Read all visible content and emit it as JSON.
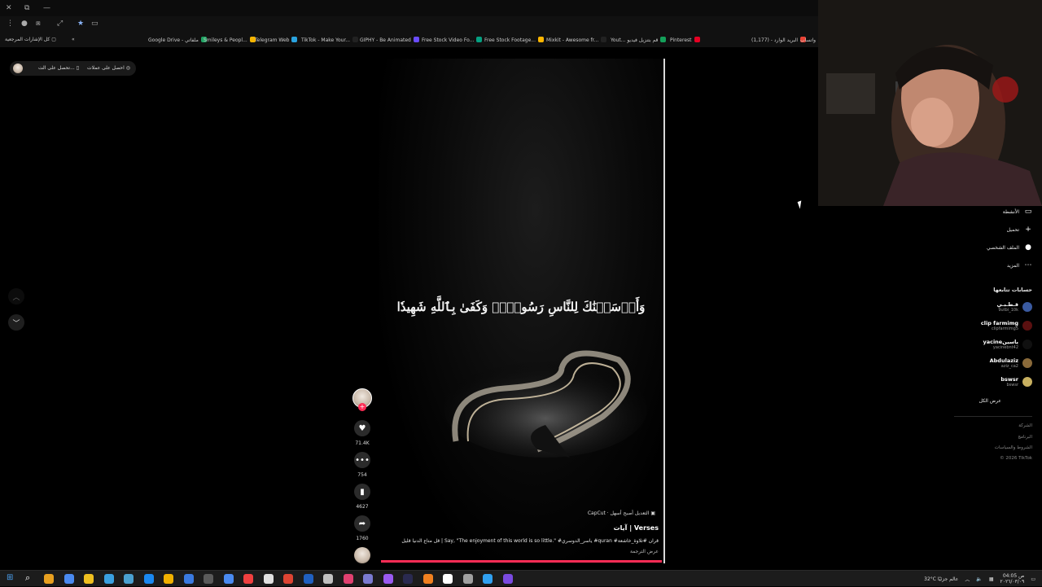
{
  "browser": {
    "window_controls": {
      "close": "✕",
      "restore": "⧉",
      "minimize": "—"
    },
    "bookmarks_all_label": "كل الإشارات المرجعية",
    "bookmarks": [
      {
        "label": "Google Drive - ملفاتي",
        "color": "#1fa463"
      },
      {
        "label": "Smileys & Peopl...",
        "color": "#f5b400"
      },
      {
        "label": "Telegram Web",
        "color": "#2aa3df"
      },
      {
        "label": "TikTok - Make Your...",
        "color": "#222222"
      },
      {
        "label": "GIPHY - Be Animated",
        "color": "#6a4cff"
      },
      {
        "label": "Free Stock Video Fo...",
        "color": "#05a081"
      },
      {
        "label": "Free Stock Footage...",
        "color": "#ffb600"
      },
      {
        "label": "Mixkit - Awesome fr...",
        "color": "#222222"
      },
      {
        "label": "Yout... قم بتنزيل فيديو",
        "color": "#14a05a"
      },
      {
        "label": "Pinterest",
        "color": "#e60023"
      },
      {
        "label": "البريد الوارد - (1,177)",
        "color": "#ea4335"
      },
      {
        "label": "واتساب",
        "color": "#25d366"
      }
    ]
  },
  "top_bar": {
    "get_app_label": "تحصل على الت...",
    "get_coins_label": "احصل على عملات"
  },
  "video": {
    "verse_text": "وَأَرۡسَلۡنَٰكَ لِلنَّاسِ رَسُولٗاۚ وَكَفَىٰ بِٱللَّهِ شَهِيدٗا",
    "capcut_label": "CapCut · التعديل أصبح أسهل",
    "title": "آيات | Verses",
    "description": "قل متاع الدنيا قليل | Say, \"The enjoyment of this world is so little.\" #ياسر_الدوسري #quran #قرآن #تلاوة_خاشعة",
    "see_translation": "عرض الترجمة",
    "progress_pct": 100
  },
  "actions": {
    "likes": "71.4K",
    "comments": "754",
    "saves": "4627",
    "shares": "1760"
  },
  "sidebar": {
    "menu": [
      {
        "label": "الأنشطة",
        "icon": "activity-icon",
        "glyph": "▭"
      },
      {
        "label": "تحميل",
        "icon": "upload-icon",
        "glyph": "+"
      },
      {
        "label": "الملف الشخصي",
        "icon": "profile-icon",
        "glyph": "●"
      },
      {
        "label": "المزيد",
        "icon": "more-icon",
        "glyph": "⋯"
      }
    ],
    "following_title": "حسابات تتابعها",
    "accounts": [
      {
        "name": "قـطـبـي",
        "username": "9utbi_10k",
        "color": "#3a5aa0"
      },
      {
        "name": "clip farmimg",
        "username": "clipfarmimg5",
        "color": "#5a1010"
      },
      {
        "name": "yacineياسين",
        "username": "yacinebnt42",
        "color": "#101010"
      },
      {
        "name": "Abdulaziz",
        "username": "aziz_ca2",
        "color": "#8a6a3a"
      },
      {
        "name": "bswsr",
        "username": "bswsr",
        "color": "#c8b060"
      }
    ],
    "see_all": "عرض الكل",
    "footer": [
      "الشركة",
      "البرنامج",
      "الشروط والسياسات",
      "© 2026 TikTok"
    ]
  },
  "taskbar": {
    "weather": "32°C عالم جزئيًا",
    "time": "04:05 ص",
    "date": "٢٠٢٦/٠٣/٠٩",
    "icons": [
      "#e8a020",
      "#4a8af0",
      "#f0c020",
      "#3aa0e0",
      "#4aa0d0",
      "#1a88f0",
      "#f0b000",
      "#3a7ae0",
      "#5a5a5a",
      "#4a8af0",
      "#f04040",
      "#e0e0e0",
      "#dd4433",
      "#2060c0",
      "#c0c0c0",
      "#e04070",
      "#7a7ad0",
      "#9a5af0",
      "#2a2a50",
      "#f08020",
      "#ffffff",
      "#a0a0a0",
      "#30a0f0",
      "#7a4ae0"
    ]
  }
}
